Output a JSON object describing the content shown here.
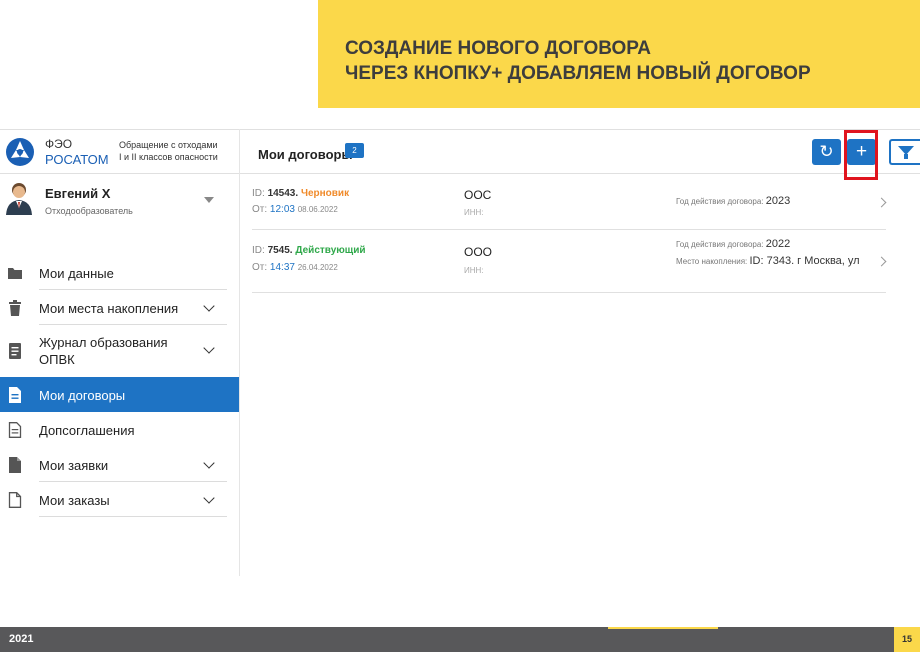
{
  "banner": {
    "line1": "СОЗДАНИЕ НОВОГО ДОГОВОРА",
    "line2": "ЧЕРЕЗ КНОПКУ+ ДОБАВЛЯЕМ НОВЫЙ ДОГОВОР",
    "color": "#fbd84a"
  },
  "logo": {
    "feo": "ФЭО",
    "rosatom": "РОСАТОМ",
    "desc_line1": "Обращение с отходами",
    "desc_line2": "I и II классов опасности"
  },
  "user": {
    "name": "Евгений Х",
    "role": "Отходообразователь"
  },
  "nav": [
    {
      "label": "Мои данные",
      "icon": "folder-icon"
    },
    {
      "label": "Мои места накопления",
      "icon": "trash-icon"
    },
    {
      "label_line1": "Журнал образования",
      "label_line2": "ОПВК",
      "icon": "journal-icon"
    },
    {
      "label": "Мои договоры",
      "icon": "document-icon",
      "active": true
    },
    {
      "label": "Допсоглашения",
      "icon": "document-outline-icon"
    },
    {
      "label": "Мои заявки",
      "icon": "file-icon"
    },
    {
      "label": "Мои заказы",
      "icon": "file-outline-icon"
    }
  ],
  "main": {
    "title": "Мои договоры",
    "count": "2",
    "add_label": "+",
    "accent": "#1e73c4",
    "highlight": "#e0141e"
  },
  "contracts": [
    {
      "id_label": "ID:",
      "id": "14543.",
      "status": "Черновик",
      "from_label": "От:",
      "time": "12:03",
      "date": "08.06.2022",
      "org": "ООС",
      "inn_label": "ИНН:",
      "year_label": "Год действия договора:",
      "year": "2023"
    },
    {
      "id_label": "ID:",
      "id": "7545.",
      "status": "Действующий",
      "from_label": "От:",
      "time": "14:37",
      "date": "26.04.2022",
      "org": "ООО",
      "inn_label": "ИНН:",
      "year_label": "Год действия договора:",
      "year": "2022",
      "place_label": "Место накопления:",
      "place": "ID: 7343. г Москва, ул"
    }
  ],
  "footer": {
    "year": "2021",
    "page": "15"
  }
}
